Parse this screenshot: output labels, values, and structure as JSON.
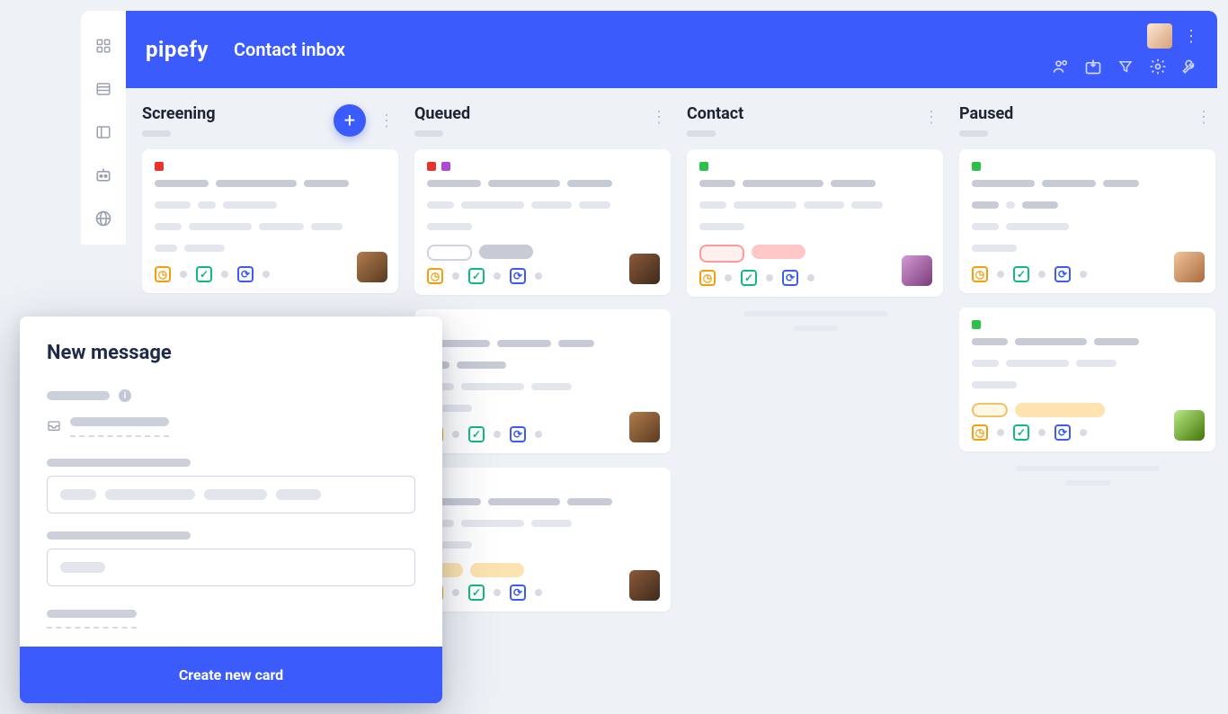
{
  "brand": "pipefy",
  "page_title": "Contact inbox",
  "columns": [
    {
      "title": "Screening",
      "has_add": true
    },
    {
      "title": "Queued",
      "has_add": false
    },
    {
      "title": "Contact",
      "has_add": false
    },
    {
      "title": "Paused",
      "has_add": false
    }
  ],
  "modal": {
    "title": "New message",
    "submit_label": "Create new card"
  },
  "icons": {
    "rail": [
      "apps",
      "list",
      "panel",
      "robot",
      "globe"
    ],
    "header": [
      "people",
      "import",
      "filter",
      "settings",
      "tools"
    ]
  }
}
